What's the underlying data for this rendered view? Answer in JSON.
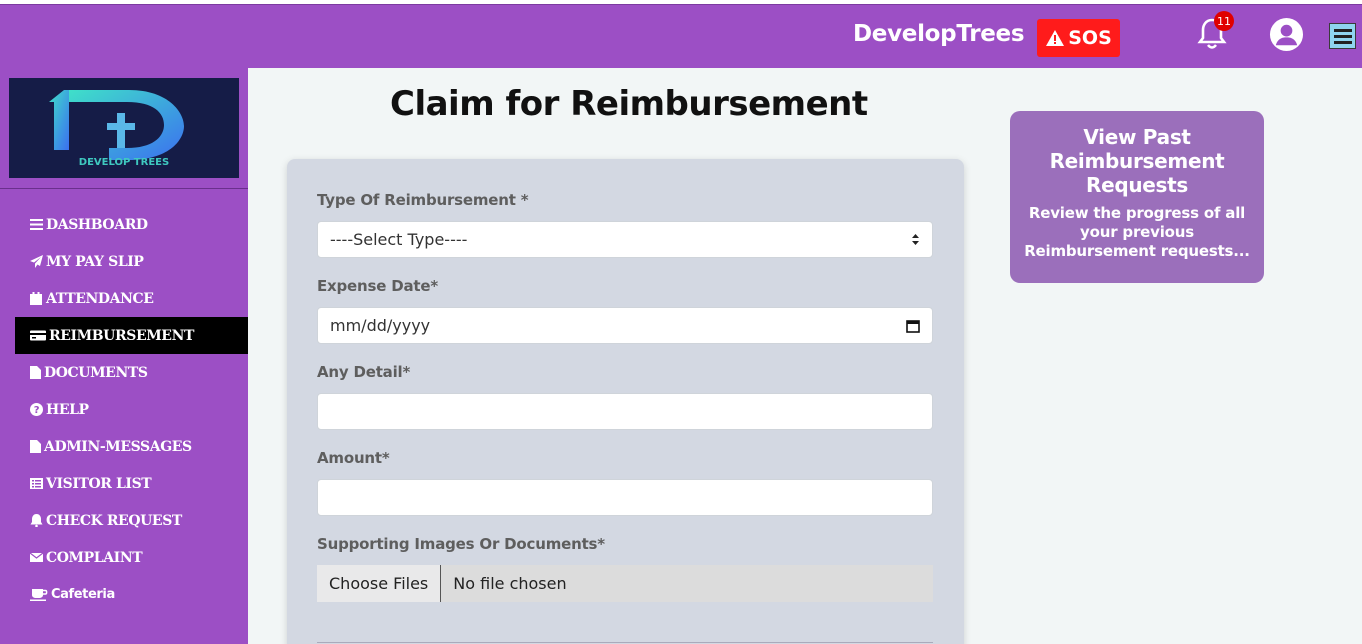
{
  "header": {
    "brand": "DevelopTrees",
    "sos_label": "SOS",
    "notification_count": "11"
  },
  "sidebar": {
    "logo_text": "DEVELOP TREES",
    "items": [
      {
        "label": "DASHBOARD",
        "icon": "bars-icon"
      },
      {
        "label": "MY PAY SLIP",
        "icon": "paper-plane-icon"
      },
      {
        "label": "ATTENDANCE",
        "icon": "calendar-icon"
      },
      {
        "label": "REIMBURSEMENT",
        "icon": "credit-card-icon",
        "active": true
      },
      {
        "label": "DOCUMENTS",
        "icon": "file-icon"
      },
      {
        "label": "HELP",
        "icon": "question-circle-icon"
      },
      {
        "label": "ADMIN-MESSAGES",
        "icon": "file-icon"
      },
      {
        "label": "VISITOR LIST",
        "icon": "list-icon"
      },
      {
        "label": "CHECK REQUEST",
        "icon": "bell-icon"
      },
      {
        "label": "COMPLAINT",
        "icon": "envelope-icon"
      },
      {
        "label": "Cafeteria",
        "icon": "coffee-icon"
      }
    ]
  },
  "main": {
    "title": "Claim for Reimbursement",
    "form": {
      "type_label": "Type Of Reimbursement *",
      "type_value": "----Select Type----",
      "date_label": "Expense Date*",
      "date_value": "mm/dd/yyyy",
      "detail_label": "Any Detail*",
      "detail_value": "",
      "amount_label": "Amount*",
      "amount_value": "",
      "files_label": "Supporting Images Or Documents*",
      "files_button": "Choose Files",
      "files_status": "No file chosen"
    }
  },
  "past_requests": {
    "title": "View Past Reimbursement Requests",
    "description": "Review the progress of all your previous Reimbursement requests..."
  },
  "colors": {
    "primary": "#9c4fc5",
    "sos": "#ff1b1b",
    "card": "#9b6fbb"
  }
}
